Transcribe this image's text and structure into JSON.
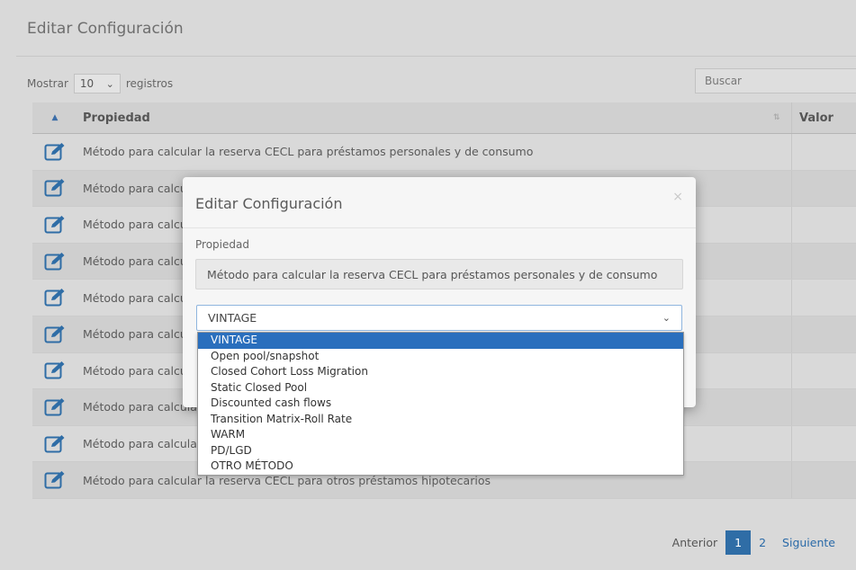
{
  "page": {
    "title": "Editar Configuración",
    "length": {
      "prefix": "Mostrar",
      "value": "10",
      "suffix": "registros"
    },
    "search_placeholder": "Buscar"
  },
  "table": {
    "headers": {
      "property": "Propiedad",
      "value": "Valor"
    },
    "rows": [
      "Método para calcular la reserva CECL para préstamos personales y de consumo",
      "Método para calcular la reserva CECL para",
      "Método para calcular la reserva CECL para",
      "Método para calcular la reserva CECL para",
      "Método para calcular la reserva CECL para",
      "Método para calcular la reserva CECL para",
      "Método para calcular la reserva CECL para",
      "Método para calcular la reserva CECL para",
      "Método para calcular la reserva CECL para",
      "Método para calcular la reserva CECL para otros préstamos hipotecarios"
    ]
  },
  "pagination": {
    "prev": "Anterior",
    "pages": [
      "1",
      "2"
    ],
    "active_page": "1",
    "next": "Siguiente"
  },
  "modal": {
    "title": "Editar Configuración",
    "close": "×",
    "property_label": "Propiedad",
    "property_value": "Método para calcular la reserva CECL para préstamos personales y de consumo",
    "selected_method": "VINTAGE",
    "options": [
      "VINTAGE",
      "Open pool/snapshot",
      "Closed Cohort Loss Migration",
      "Static Closed Pool",
      "Discounted cash flows",
      "Transition Matrix-Roll Rate",
      "WARM",
      "PD/LGD",
      "OTRO MÉTODO"
    ]
  },
  "colors": {
    "accent": "#2a6fbd",
    "edit_icon": "#2f6da6"
  }
}
